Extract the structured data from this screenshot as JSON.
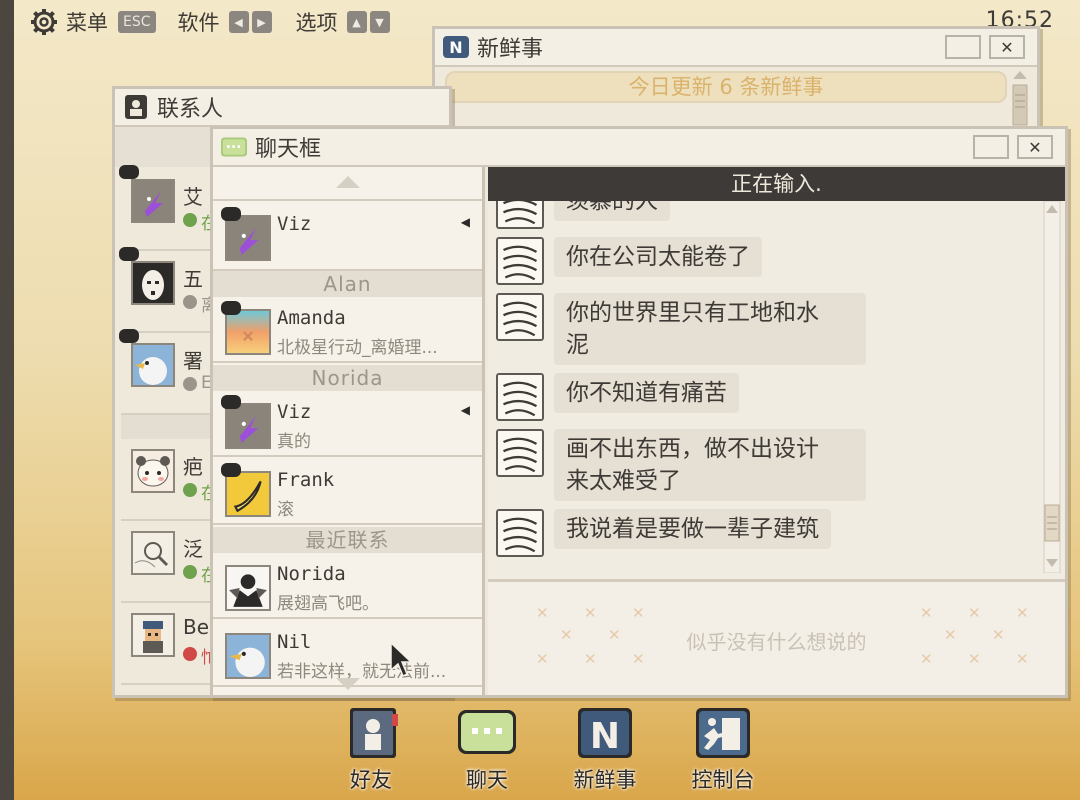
{
  "menubar": {
    "menu_label": "菜单",
    "esc_label": "ESC",
    "software_label": "软件",
    "options_label": "选项",
    "clock": "16:52"
  },
  "news_window": {
    "title": "新鲜事",
    "banner": "今日更新 6 条新鲜事"
  },
  "contacts_window": {
    "title": "联系人",
    "items": [
      {
        "name": "艾",
        "status": "在",
        "status_color": "#6fa24d"
      },
      {
        "name": "五",
        "status": "离",
        "status_color": "#9a948a"
      },
      {
        "name": "署",
        "status": "E",
        "status_color": "#9a948a"
      },
      {
        "name": "疤",
        "status": "在",
        "status_color": "#6fa24d"
      },
      {
        "name": "泛",
        "status": "在",
        "status_color": "#6fa24d"
      },
      {
        "name": "Be",
        "status": "忙",
        "status_color": "#d04848"
      }
    ]
  },
  "chat_window": {
    "title": "聊天框",
    "typing_status": "正在输入.",
    "input_placeholder": "似乎没有什么想说的",
    "list": {
      "top_entry": {
        "name": "Viz",
        "preview": ""
      },
      "section_alan": "Alan",
      "amanda": {
        "name": "Amanda",
        "preview": "北极星行动_离婚理..."
      },
      "section_norida": "Norida",
      "viz": {
        "name": "Viz",
        "preview": "真的"
      },
      "frank": {
        "name": "Frank",
        "preview": "滚"
      },
      "section_recent": "最近联系",
      "norida": {
        "name": "Norida",
        "preview": "展翅高飞吧。"
      },
      "nil": {
        "name": "Nil",
        "preview": "若非这样，就无法前..."
      }
    },
    "messages": [
      {
        "text": "羡慕的人"
      },
      {
        "text": "你在公司太能卷了"
      },
      {
        "text": "你的世界里只有工地和水",
        "text2": "泥"
      },
      {
        "text": "你不知道有痛苦"
      },
      {
        "text": "画不出东西，做不出设计",
        "text2": "来太难受了"
      },
      {
        "text": "我说着是要做一辈子建筑"
      }
    ]
  },
  "dock": {
    "friends": "好友",
    "chat": "聊天",
    "news": "新鲜事",
    "console": "控制台"
  }
}
